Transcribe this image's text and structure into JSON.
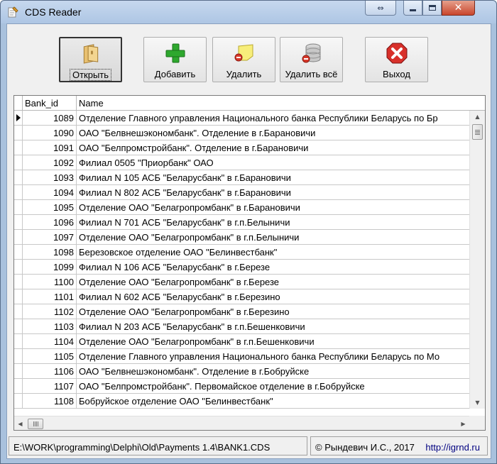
{
  "window": {
    "title": "CDS Reader"
  },
  "toolbar": {
    "open_label": "Открыть",
    "add_label": "Добавить",
    "delete_label": "Удалить",
    "delete_all_label": "Удалить всё",
    "exit_label": "Выход"
  },
  "grid": {
    "columns": [
      "Bank_id",
      "Name"
    ],
    "rows": [
      {
        "id": "1089",
        "name": "Отделение Главного управления Национального банка Республики Беларусь по Бр"
      },
      {
        "id": "1090",
        "name": "ОАО \"Белвнешэкономбанк\". Отделение в г.Барановичи"
      },
      {
        "id": "1091",
        "name": "ОАО \"Белпромстройбанк\". Отделение в г.Барановичи"
      },
      {
        "id": "1092",
        "name": "Филиал 0505 \"Приорбанк\" ОАО"
      },
      {
        "id": "1093",
        "name": "Филиал N 105 АСБ \"Беларусбанк\" в г.Барановичи"
      },
      {
        "id": "1094",
        "name": "Филиал N 802 АСБ \"Беларусбанк\" в г.Барановичи"
      },
      {
        "id": "1095",
        "name": "Отделение ОАО \"Белагропромбанк\" в г.Барановичи"
      },
      {
        "id": "1096",
        "name": "Филиал N 701 АСБ \"Беларусбанк\" в г.п.Белыничи"
      },
      {
        "id": "1097",
        "name": "Отделение ОАО \"Белагропромбанк\" в г.п.Белыничи"
      },
      {
        "id": "1098",
        "name": "Березовское отделение ОАО \"Белинвестбанк\""
      },
      {
        "id": "1099",
        "name": "Филиал N 106 АСБ \"Беларусбанк\" в г.Березе"
      },
      {
        "id": "1100",
        "name": "Отделение ОАО \"Белагропромбанк\" в г.Березе"
      },
      {
        "id": "1101",
        "name": "Филиал N 602 АСБ \"Беларусбанк\" в г.Березино"
      },
      {
        "id": "1102",
        "name": "Отделение ОАО \"Белагропромбанк\" в г.Березино"
      },
      {
        "id": "1103",
        "name": "Филиал N 203 АСБ \"Беларусбанк\" в г.п.Бешенковичи"
      },
      {
        "id": "1104",
        "name": "Отделение ОАО \"Белагропромбанк\" в г.п.Бешенковичи"
      },
      {
        "id": "1105",
        "name": "Отделение Главного управления Национального банка Республики Беларусь по Мо"
      },
      {
        "id": "1106",
        "name": "ОАО \"Белвнешэкономбанк\". Отделение в г.Бобруйске"
      },
      {
        "id": "1107",
        "name": "ОАО \"Белпромстройбанк\". Первомайское отделение в г.Бобруйске"
      },
      {
        "id": "1108",
        "name": "Бобруйское отделение ОАО \"Белинвестбанк\""
      }
    ]
  },
  "status": {
    "path": "E:\\WORK\\programming\\Delphi\\Old\\Payments 1.4\\BANK1.CDS",
    "copyright": "© Рындевич И.С., 2017",
    "link": "http://igrnd.ru"
  },
  "colors": {
    "title_bar": "#aec6e4",
    "close_button": "#c9462c",
    "link": "#000080"
  }
}
